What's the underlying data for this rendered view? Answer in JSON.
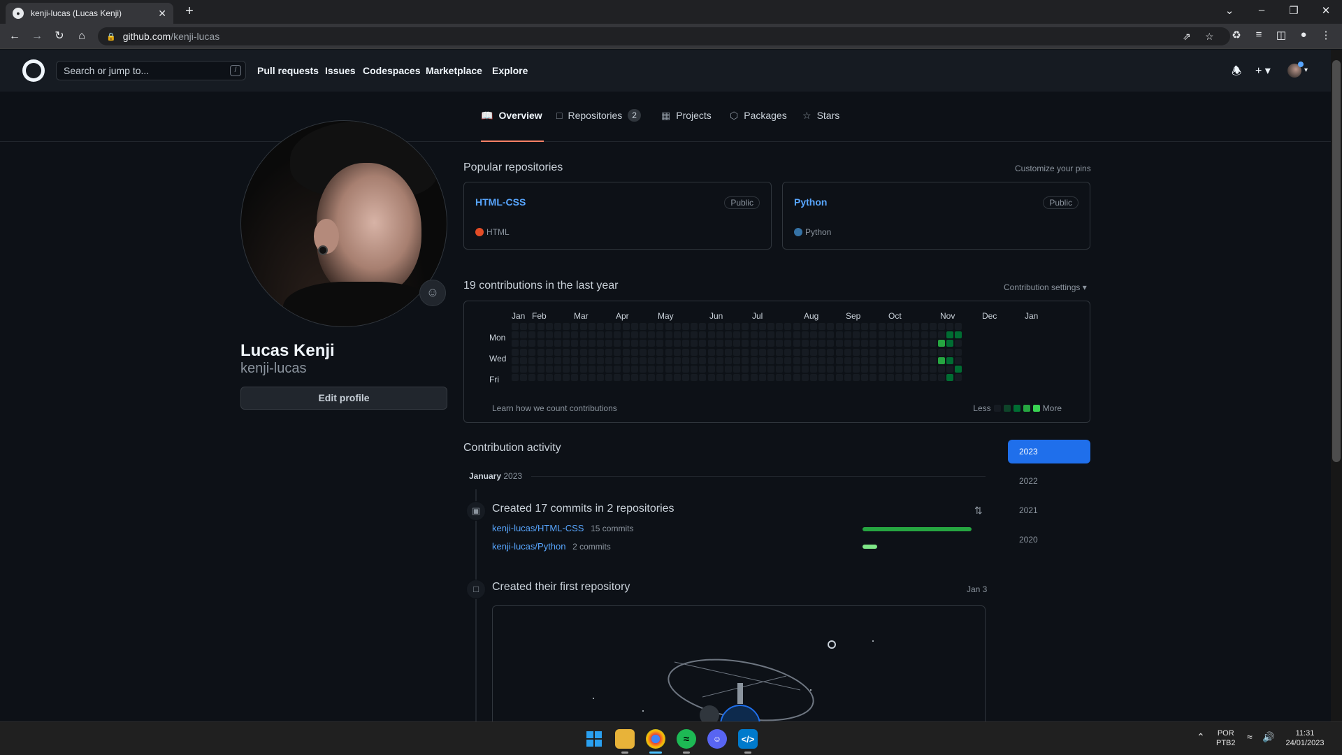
{
  "browser": {
    "tab_title": "kenji-lucas (Lucas Kenji)",
    "url_host": "github.com",
    "url_path": "/kenji-lucas"
  },
  "header": {
    "search_placeholder": "Search or jump to...",
    "search_key": "/",
    "nav": [
      "Pull requests",
      "Issues",
      "Codespaces",
      "Marketplace",
      "Explore"
    ]
  },
  "tabs": [
    {
      "label": "Overview",
      "icon": "book-icon"
    },
    {
      "label": "Repositories",
      "icon": "repo-icon",
      "count": "2"
    },
    {
      "label": "Projects",
      "icon": "table-icon"
    },
    {
      "label": "Packages",
      "icon": "package-icon"
    },
    {
      "label": "Stars",
      "icon": "star-icon"
    }
  ],
  "profile": {
    "name": "Lucas Kenji",
    "username": "kenji-lucas",
    "edit_label": "Edit profile"
  },
  "popular": {
    "title": "Popular repositories",
    "customize": "Customize your pins",
    "repos": [
      {
        "name": "HTML-CSS",
        "visibility": "Public",
        "language": "HTML",
        "color": "#e34c26"
      },
      {
        "name": "Python",
        "visibility": "Public",
        "language": "Python",
        "color": "#3572A5"
      }
    ]
  },
  "contributions": {
    "title": "19 contributions in the last year",
    "settings": "Contribution settings ▾",
    "months": [
      "Jan",
      "Feb",
      "Mar",
      "Apr",
      "May",
      "Jun",
      "Jul",
      "Aug",
      "Sep",
      "Oct",
      "Nov",
      "Dec",
      "Jan"
    ],
    "days": [
      "Mon",
      "Wed",
      "Fri"
    ],
    "learn": "Learn how we count contributions",
    "less": "Less",
    "more": "More",
    "levels": [
      "#161b22",
      "#0e4429",
      "#006d32",
      "#26a641",
      "#39d353"
    ],
    "active_cells": [
      {
        "week": 50,
        "day": 2,
        "level": 3
      },
      {
        "week": 50,
        "day": 4,
        "level": 3
      },
      {
        "week": 51,
        "day": 1,
        "level": 2
      },
      {
        "week": 51,
        "day": 2,
        "level": 2
      },
      {
        "week": 51,
        "day": 4,
        "level": 2
      },
      {
        "week": 51,
        "day": 6,
        "level": 2
      },
      {
        "week": 52,
        "day": 1,
        "level": 2
      },
      {
        "week": 52,
        "day": 5,
        "level": 2
      }
    ]
  },
  "activity": {
    "title": "Contribution activity",
    "month": "January",
    "year": "2023",
    "years": [
      "2023",
      "2022",
      "2021",
      "2020"
    ],
    "commits_title": "Created 17 commits in 2 repositories",
    "commit_repos": [
      {
        "repo": "kenji-lucas/HTML-CSS",
        "commits": "15 commits",
        "count": 15
      },
      {
        "repo": "kenji-lucas/Python",
        "commits": "2 commits",
        "count": 2
      }
    ],
    "first_repo_title": "Created their first repository",
    "first_repo_date": "Jan 3"
  },
  "taskbar": {
    "lang": "POR",
    "layout": "PTB2",
    "time": "11:31",
    "date": "24/01/2023"
  }
}
